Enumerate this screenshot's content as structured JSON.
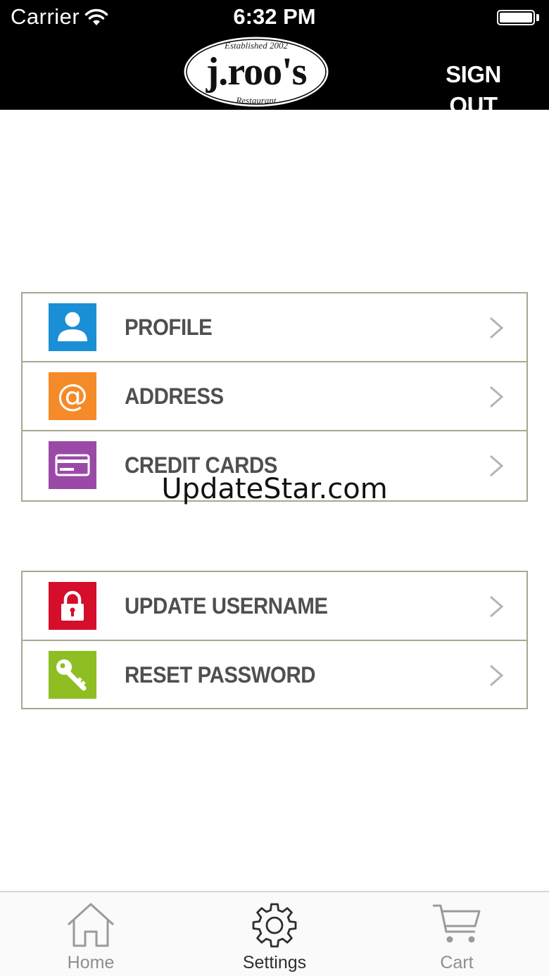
{
  "status_bar": {
    "carrier": "Carrier",
    "time": "6:32 PM"
  },
  "header": {
    "logo": {
      "top_text": "Established 2002",
      "name": "j.roo's",
      "bottom_text": "Restaurant"
    },
    "sign_out_label": "SIGN OUT"
  },
  "menu": {
    "group1": [
      {
        "label": "PROFILE",
        "icon": "person-icon",
        "color": "#1a8fd5"
      },
      {
        "label": "ADDRESS",
        "icon": "at-sign-icon",
        "color": "#f58a28"
      },
      {
        "label": "CREDIT CARDS",
        "icon": "credit-card-icon",
        "color": "#9a4aa6"
      }
    ],
    "group2": [
      {
        "label": "UPDATE USERNAME",
        "icon": "lock-icon",
        "color": "#d50e2b"
      },
      {
        "label": "RESET PASSWORD",
        "icon": "key-icon",
        "color": "#8ebe22"
      }
    ]
  },
  "watermark": "UpdateStar.com",
  "tabbar": {
    "home": "Home",
    "settings": "Settings",
    "cart": "Cart",
    "active": "settings"
  },
  "colors": {
    "header_bg": "#000000",
    "row_border": "#a7a88e",
    "label_text": "#4f4f4f",
    "tab_inactive": "#8e8e8e",
    "tab_active": "#2e2e2e"
  }
}
